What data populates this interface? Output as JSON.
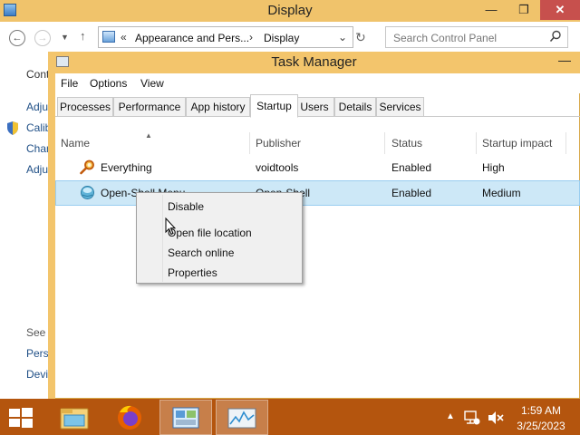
{
  "control_panel": {
    "title": "Display",
    "breadcrumb_chevron": "«",
    "breadcrumb": [
      "Appearance and Pers...",
      "Display"
    ],
    "breadcrumb_separator": "›",
    "search_placeholder": "Search Control Panel",
    "left_pane": [
      "Cont",
      "Adju",
      "Calib",
      "Chan",
      "Adju",
      "See a",
      "Pers",
      "Devi"
    ]
  },
  "task_manager": {
    "title": "Task Manager",
    "menu": [
      "File",
      "Options",
      "View"
    ],
    "tabs": [
      "Processes",
      "Performance",
      "App history",
      "Startup",
      "Users",
      "Details",
      "Services"
    ],
    "active_tab": "Startup",
    "columns": [
      "Name",
      "Publisher",
      "Status",
      "Startup impact"
    ],
    "rows": [
      {
        "name": "Everything",
        "publisher": "voidtools",
        "status": "Enabled",
        "impact": "High",
        "icon": "magnifier-key-icon"
      },
      {
        "name": "Open-Shell Menu",
        "publisher": "Open-Shell",
        "status": "Enabled",
        "impact": "Medium",
        "icon": "shell-orb-icon",
        "selected": true
      }
    ]
  },
  "context_menu": {
    "items": [
      "Disable",
      "Open file location",
      "Search online",
      "Properties"
    ]
  },
  "taskbar": {
    "apps": [
      "file-explorer-icon",
      "firefox-icon",
      "control-panel-icon",
      "task-manager-icon"
    ],
    "time": "1:59 AM",
    "date": "3/25/2023"
  },
  "colors": {
    "accent_titlebar": "#f3c56c",
    "taskbar": "#b4550e",
    "selection": "#cde8f7"
  }
}
